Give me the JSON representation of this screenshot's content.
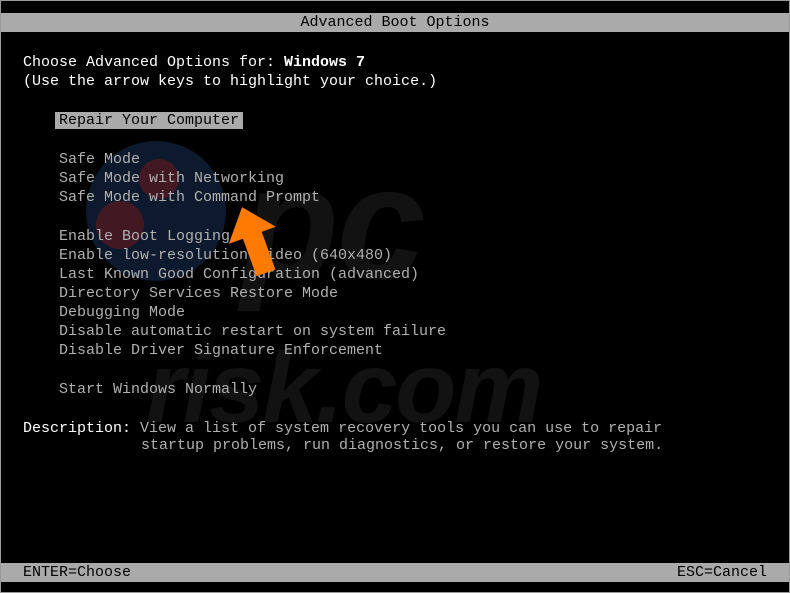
{
  "title": "Advanced Boot Options",
  "prompt": {
    "text": "Choose Advanced Options for: ",
    "os": "Windows 7"
  },
  "hint": "(Use the arrow keys to highlight your choice.)",
  "menu": {
    "groups": [
      [
        "Repair Your Computer"
      ],
      [
        "Safe Mode",
        "Safe Mode with Networking",
        "Safe Mode with Command Prompt"
      ],
      [
        "Enable Boot Logging",
        "Enable low-resolution video (640x480)",
        "Last Known Good Configuration (advanced)",
        "Directory Services Restore Mode",
        "Debugging Mode",
        "Disable automatic restart on system failure",
        "Disable Driver Signature Enforcement"
      ],
      [
        "Start Windows Normally"
      ]
    ],
    "selected": "Repair Your Computer"
  },
  "description": {
    "label": "Description: ",
    "line1": "View a list of system recovery tools you can use to repair",
    "line2": "startup problems, run diagnostics, or restore your system."
  },
  "footer": {
    "left": "ENTER=Choose",
    "right": "ESC=Cancel"
  },
  "watermark": {
    "text1": "pc",
    "text2": "risk.com"
  }
}
